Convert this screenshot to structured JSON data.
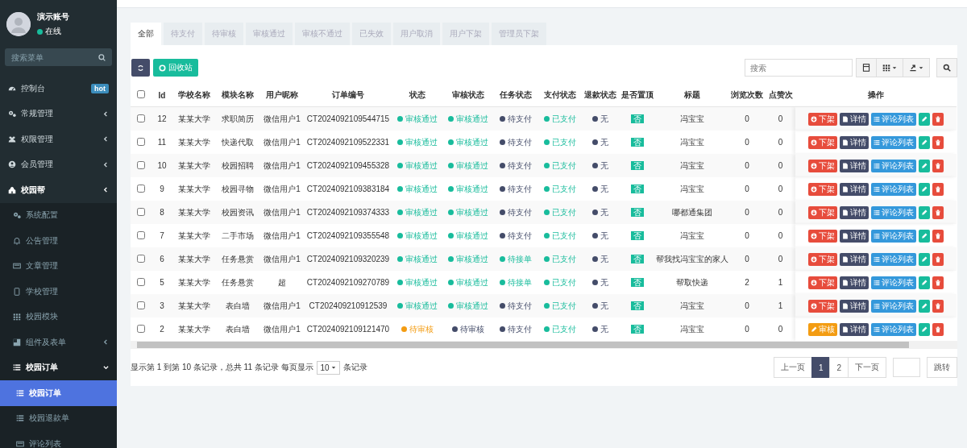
{
  "user": {
    "name": "演示账号",
    "status": "在线",
    "online": true
  },
  "sidebar": {
    "search": {
      "placeholder": "搜索菜单"
    },
    "items": [
      {
        "label": "控制台",
        "badge": "hot"
      },
      {
        "label": "常规管理",
        "expanded": false
      },
      {
        "label": "权限管理",
        "expanded": false
      },
      {
        "label": "会员管理",
        "expanded": false
      },
      {
        "label": "校园帮",
        "expanded": false,
        "children": [
          {
            "label": "系统配置"
          },
          {
            "label": "公告管理"
          },
          {
            "label": "文章管理"
          },
          {
            "label": "学校管理"
          },
          {
            "label": "校园模块"
          },
          {
            "label": "组件及表单",
            "expanded": false
          },
          {
            "label": "校园订单",
            "expanded": true,
            "children": [
              {
                "label": "校园订单",
                "selected": true
              },
              {
                "label": "校园退款单",
                "selected": false
              },
              {
                "label": "评论列表",
                "selected": false
              }
            ]
          }
        ]
      }
    ]
  },
  "tabs": [
    {
      "label": "全部",
      "selected": true
    },
    {
      "label": "待支付",
      "selected": false
    },
    {
      "label": "待审核",
      "selected": false
    },
    {
      "label": "审核通过",
      "selected": false
    },
    {
      "label": "审核不通过",
      "selected": false
    },
    {
      "label": "已失效",
      "selected": false
    },
    {
      "label": "用户取消",
      "selected": false
    },
    {
      "label": "用户下架",
      "selected": false
    },
    {
      "label": "管理员下架",
      "selected": false
    }
  ],
  "toolbar": {
    "recycle_label": "回收站",
    "search_placeholder": "搜索"
  },
  "table": {
    "select_all_checked": false,
    "columns": [
      "Id",
      "学校名称",
      "模块名称",
      "用户昵称",
      "订单编号",
      "状态",
      "审核状态",
      "任务状态",
      "支付状态",
      "退款状态",
      "是否置顶",
      "标题",
      "浏览次数",
      "点赞次",
      "操作"
    ],
    "rows": [
      {
        "checked": false,
        "id": "12",
        "school": "某某大学",
        "module": "求职简历",
        "user": "微信用户1",
        "order_no": "CT2024092109544715",
        "status": {
          "text": "审核通过",
          "color": "#18bc9c"
        },
        "audit": {
          "text": "审核通过",
          "color": "#18bc9c"
        },
        "task": {
          "text": "待支付",
          "color": "#444c69"
        },
        "pay": {
          "text": "已支付",
          "color": "#18bc9c"
        },
        "refund": {
          "text": "无",
          "color": "#444c69"
        },
        "pinned": "否",
        "title": "冯宝宝",
        "views": "0",
        "likes": "0",
        "action": {
          "kind": "takedown",
          "label": "下架"
        },
        "detail": "详情",
        "comments": "评论列表"
      },
      {
        "checked": false,
        "id": "11",
        "school": "某某大学",
        "module": "快递代取",
        "user": "微信用户1",
        "order_no": "CT2024092109522331",
        "status": {
          "text": "审核通过",
          "color": "#18bc9c"
        },
        "audit": {
          "text": "审核通过",
          "color": "#18bc9c"
        },
        "task": {
          "text": "待支付",
          "color": "#444c69"
        },
        "pay": {
          "text": "已支付",
          "color": "#18bc9c"
        },
        "refund": {
          "text": "无",
          "color": "#444c69"
        },
        "pinned": "否",
        "title": "冯宝宝",
        "views": "0",
        "likes": "0",
        "action": {
          "kind": "takedown",
          "label": "下架"
        },
        "detail": "详情",
        "comments": "评论列表"
      },
      {
        "checked": false,
        "id": "10",
        "school": "某某大学",
        "module": "校园招聘",
        "user": "微信用户1",
        "order_no": "CT2024092109455328",
        "status": {
          "text": "审核通过",
          "color": "#18bc9c"
        },
        "audit": {
          "text": "审核通过",
          "color": "#18bc9c"
        },
        "task": {
          "text": "待支付",
          "color": "#444c69"
        },
        "pay": {
          "text": "已支付",
          "color": "#18bc9c"
        },
        "refund": {
          "text": "无",
          "color": "#444c69"
        },
        "pinned": "否",
        "title": "冯宝宝",
        "views": "0",
        "likes": "0",
        "action": {
          "kind": "takedown",
          "label": "下架"
        },
        "detail": "详情",
        "comments": "评论列表"
      },
      {
        "checked": false,
        "id": "9",
        "school": "某某大学",
        "module": "校园寻物",
        "user": "微信用户1",
        "order_no": "CT2024092109383184",
        "status": {
          "text": "审核通过",
          "color": "#18bc9c"
        },
        "audit": {
          "text": "审核通过",
          "color": "#18bc9c"
        },
        "task": {
          "text": "待支付",
          "color": "#444c69"
        },
        "pay": {
          "text": "已支付",
          "color": "#18bc9c"
        },
        "refund": {
          "text": "无",
          "color": "#444c69"
        },
        "pinned": "否",
        "title": "冯宝宝",
        "views": "0",
        "likes": "0",
        "action": {
          "kind": "takedown",
          "label": "下架"
        },
        "detail": "详情",
        "comments": "评论列表"
      },
      {
        "checked": false,
        "id": "8",
        "school": "某某大学",
        "module": "校园资讯",
        "user": "微信用户1",
        "order_no": "CT2024092109374333",
        "status": {
          "text": "审核通过",
          "color": "#18bc9c"
        },
        "audit": {
          "text": "审核通过",
          "color": "#18bc9c"
        },
        "task": {
          "text": "待支付",
          "color": "#444c69"
        },
        "pay": {
          "text": "已支付",
          "color": "#18bc9c"
        },
        "refund": {
          "text": "无",
          "color": "#444c69"
        },
        "pinned": "否",
        "title": "哪都通集团",
        "views": "0",
        "likes": "0",
        "action": {
          "kind": "takedown",
          "label": "下架"
        },
        "detail": "详情",
        "comments": "评论列表"
      },
      {
        "checked": false,
        "id": "7",
        "school": "某某大学",
        "module": "二手市场",
        "user": "微信用户1",
        "order_no": "CT2024092109355548",
        "status": {
          "text": "审核通过",
          "color": "#18bc9c"
        },
        "audit": {
          "text": "审核通过",
          "color": "#18bc9c"
        },
        "task": {
          "text": "待支付",
          "color": "#444c69"
        },
        "pay": {
          "text": "已支付",
          "color": "#18bc9c"
        },
        "refund": {
          "text": "无",
          "color": "#444c69"
        },
        "pinned": "否",
        "title": "冯宝宝",
        "views": "0",
        "likes": "0",
        "action": {
          "kind": "takedown",
          "label": "下架"
        },
        "detail": "详情",
        "comments": "评论列表"
      },
      {
        "checked": false,
        "id": "6",
        "school": "某某大学",
        "module": "任务悬赏",
        "user": "微信用户1",
        "order_no": "CT2024092109320239",
        "status": {
          "text": "审核通过",
          "color": "#18bc9c"
        },
        "audit": {
          "text": "审核通过",
          "color": "#18bc9c"
        },
        "task": {
          "text": "待接单",
          "color": "#18bc9c"
        },
        "pay": {
          "text": "已支付",
          "color": "#18bc9c"
        },
        "refund": {
          "text": "无",
          "color": "#444c69"
        },
        "pinned": "否",
        "title": "帮我找冯宝宝的家人",
        "views": "0",
        "likes": "0",
        "action": {
          "kind": "takedown",
          "label": "下架"
        },
        "detail": "详情",
        "comments": "评论列表"
      },
      {
        "checked": false,
        "id": "5",
        "school": "某某大学",
        "module": "任务悬赏",
        "user": "超",
        "order_no": "CT2024092109270789",
        "status": {
          "text": "审核通过",
          "color": "#18bc9c"
        },
        "audit": {
          "text": "审核通过",
          "color": "#18bc9c"
        },
        "task": {
          "text": "待接单",
          "color": "#18bc9c"
        },
        "pay": {
          "text": "已支付",
          "color": "#18bc9c"
        },
        "refund": {
          "text": "无",
          "color": "#444c69"
        },
        "pinned": "否",
        "title": "帮取快递",
        "views": "2",
        "likes": "1",
        "action": {
          "kind": "takedown",
          "label": "下架"
        },
        "detail": "详情",
        "comments": "评论列表"
      },
      {
        "checked": false,
        "id": "3",
        "school": "某某大学",
        "module": "表白墙",
        "user": "微信用户1",
        "order_no": "CT202409210912539",
        "status": {
          "text": "审核通过",
          "color": "#18bc9c"
        },
        "audit": {
          "text": "审核通过",
          "color": "#18bc9c"
        },
        "task": {
          "text": "待支付",
          "color": "#444c69"
        },
        "pay": {
          "text": "已支付",
          "color": "#18bc9c"
        },
        "refund": {
          "text": "无",
          "color": "#444c69"
        },
        "pinned": "否",
        "title": "冯宝宝",
        "views": "0",
        "likes": "1",
        "action": {
          "kind": "takedown",
          "label": "下架"
        },
        "detail": "详情",
        "comments": "评论列表"
      },
      {
        "checked": false,
        "id": "2",
        "school": "某某大学",
        "module": "表白墙",
        "user": "微信用户1",
        "order_no": "CT2024092109121470",
        "status": {
          "text": "待审核",
          "color": "#f39c12"
        },
        "audit": {
          "text": "待审核",
          "color": "#444c69"
        },
        "task": {
          "text": "待支付",
          "color": "#444c69"
        },
        "pay": {
          "text": "已支付",
          "color": "#18bc9c"
        },
        "refund": {
          "text": "无",
          "color": "#444c69"
        },
        "pinned": "否",
        "title": "冯宝宝",
        "views": "0",
        "likes": "0",
        "action": {
          "kind": "review",
          "label": "审核"
        },
        "detail": "详情",
        "comments": "评论列表"
      }
    ]
  },
  "footer": {
    "summary": "显示第 1 到第 10 条记录，总共 11 条记录 每页显示",
    "page_size": "10",
    "page_size_suffix": "条记录",
    "pagination": {
      "prev": "上一页",
      "pages": [
        {
          "label": "1",
          "selected": true
        },
        {
          "label": "2",
          "selected": false
        }
      ],
      "next": "下一页",
      "jump": "跳转"
    }
  }
}
